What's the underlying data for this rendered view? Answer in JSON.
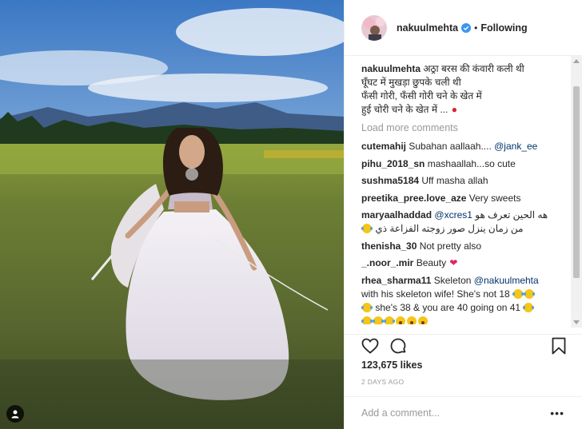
{
  "post": {
    "username": "nakuulmehta",
    "follow_separator": "•",
    "follow_status": "Following",
    "caption": {
      "handle": "nakuulmehta",
      "lines": [
        "अठ्रा बरस की कंवारी कली थी",
        "घूँघट में मुखड़ा छुपके चली थी",
        "फँसी गोरी, फँसी गोरी चने के खेत में",
        "हुई चोरी चने के खेत में ..."
      ]
    },
    "load_more": "Load more comments",
    "comments": [
      {
        "handle": "cutemahij",
        "text": "Subahan aallaah....",
        "mention": "@jank_ee"
      },
      {
        "handle": "pihu_2018_sn",
        "text": "mashaallah...so cute"
      },
      {
        "handle": "sushma5184",
        "text": "Uff masha allah"
      },
      {
        "handle": "preetika_pree.love_aze",
        "text": "Very sweets"
      },
      {
        "handle": "maryaalhaddad",
        "mention": "@xcres1",
        "text": "هه الحين تعرف هو",
        "text2": "من زمان ينزل صور زوجته الفزاعة ذي"
      },
      {
        "handle": "thenisha_30",
        "text": "Not pretty also"
      },
      {
        "handle": "_.noor_.mir",
        "text": "Beauty"
      },
      {
        "handle": "rhea_sharma11",
        "text": "Skeleton",
        "mention": "@nakuulmehta",
        "text2": "with his skeleton wife! She's not 18",
        "text3": "she's 38 & you are 40 going on 41"
      }
    ],
    "likes": "123,675 likes",
    "date": "2 DAYS AGO",
    "add_comment_placeholder": "Add a comment...",
    "more_options": "•••"
  },
  "icons": {
    "verified": "verified-badge-icon",
    "like": "heart-icon",
    "comment": "speech-bubble-icon",
    "save": "bookmark-icon",
    "tag": "person-tag-icon"
  },
  "colors": {
    "text": "#262626",
    "muted": "#999999",
    "link": "#003569",
    "verified": "#3897f0",
    "border": "#efefef"
  }
}
